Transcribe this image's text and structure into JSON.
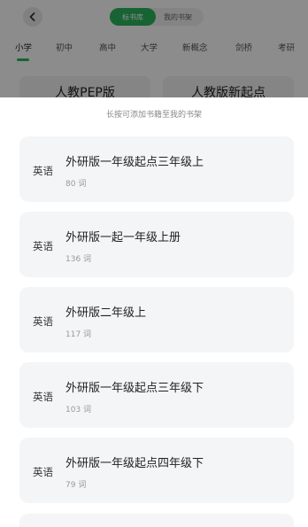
{
  "header": {
    "segments": [
      {
        "label": "标书库",
        "active": true
      },
      {
        "label": "我的书架",
        "active": false
      }
    ]
  },
  "tabs": [
    {
      "label": "小学",
      "active": true
    },
    {
      "label": "初中",
      "active": false
    },
    {
      "label": "高中",
      "active": false
    },
    {
      "label": "大学",
      "active": false
    },
    {
      "label": "新概念",
      "active": false
    },
    {
      "label": "剑桥",
      "active": false
    },
    {
      "label": "考研",
      "active": false
    }
  ],
  "background_cards": [
    {
      "title": "人教PEP版"
    },
    {
      "title": "人教版新起点"
    }
  ],
  "sheet": {
    "hint": "长按可添加书籍至我的书架",
    "books": [
      {
        "subject": "英语",
        "title": "外研版一年级起点三年级上",
        "count": "80 词"
      },
      {
        "subject": "英语",
        "title": "外研版一起一年级上册",
        "count": "136 词"
      },
      {
        "subject": "英语",
        "title": "外研版二年级上",
        "count": "117 词"
      },
      {
        "subject": "英语",
        "title": "外研版一年级起点三年级下",
        "count": "103 词"
      },
      {
        "subject": "英语",
        "title": "外研版一年级起点四年级下",
        "count": "79 词"
      }
    ]
  },
  "colors": {
    "accent": "#2db55d",
    "card_bg": "#f4f5f7",
    "overlay": "rgba(0,0,0,0.45)"
  }
}
